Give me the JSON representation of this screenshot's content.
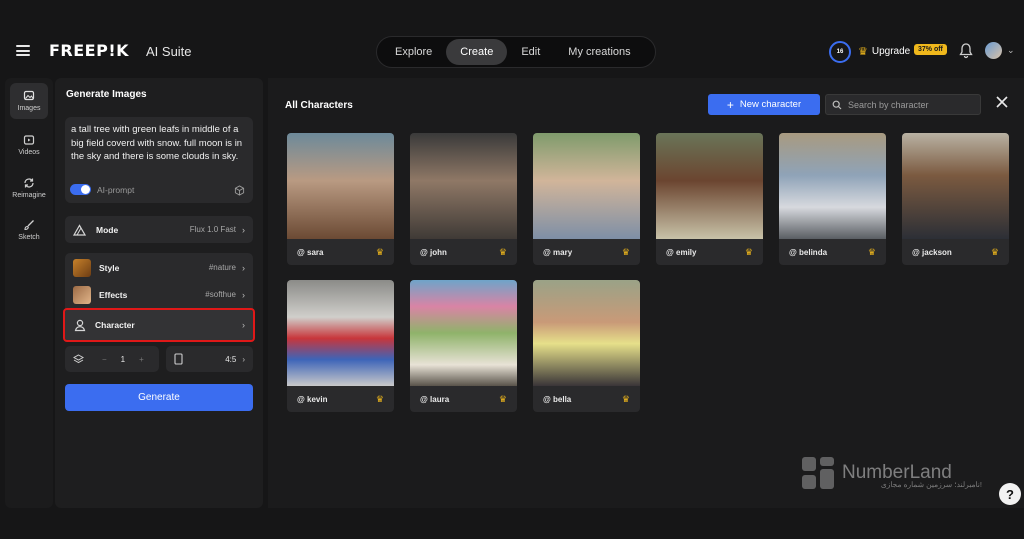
{
  "header": {
    "logo": "FREEP!K",
    "suite": "AI Suite",
    "nav": [
      "Explore",
      "Create",
      "Edit",
      "My creations"
    ],
    "active_nav": "Create",
    "credits": "16",
    "upgrade_label": "Upgrade",
    "discount_badge": "37% off"
  },
  "rail": {
    "items": [
      {
        "label": "Images",
        "icon": "image-icon"
      },
      {
        "label": "Videos",
        "icon": "video-icon"
      },
      {
        "label": "Reimagine",
        "icon": "refresh-icon"
      },
      {
        "label": "Sketch",
        "icon": "brush-icon"
      }
    ]
  },
  "panel": {
    "title": "Generate Images",
    "prompt": "a tall tree with green leafs in middle of a big field coverd with snow. full moon is in the sky and there is some clouds in sky.",
    "ai_prompt_label": "AI-prompt",
    "mode_label": "Mode",
    "mode_value": "Flux 1.0 Fast",
    "style_label": "Style",
    "style_value": "#nature",
    "effects_label": "Effects",
    "effects_value": "#softhue",
    "character_label": "Character",
    "quantity": "1",
    "ratio": "4:5",
    "generate_label": "Generate"
  },
  "main": {
    "title": "All Characters",
    "new_character_label": "New character",
    "search_placeholder": "Search by character",
    "characters": [
      {
        "name": "@ sara"
      },
      {
        "name": "@ john"
      },
      {
        "name": "@ mary"
      },
      {
        "name": "@ emily"
      },
      {
        "name": "@ belinda"
      },
      {
        "name": "@ jackson"
      },
      {
        "name": "@ kevin"
      },
      {
        "name": "@ laura"
      },
      {
        "name": "@ bella"
      }
    ]
  },
  "watermark": {
    "brand": "NumberLand",
    "tagline": "نامبرلند؛ سرزمین شماره مجازی!"
  },
  "colors": {
    "accent": "#3b6df0",
    "crown": "#f0b81c",
    "highlight_border": "#e01818"
  }
}
